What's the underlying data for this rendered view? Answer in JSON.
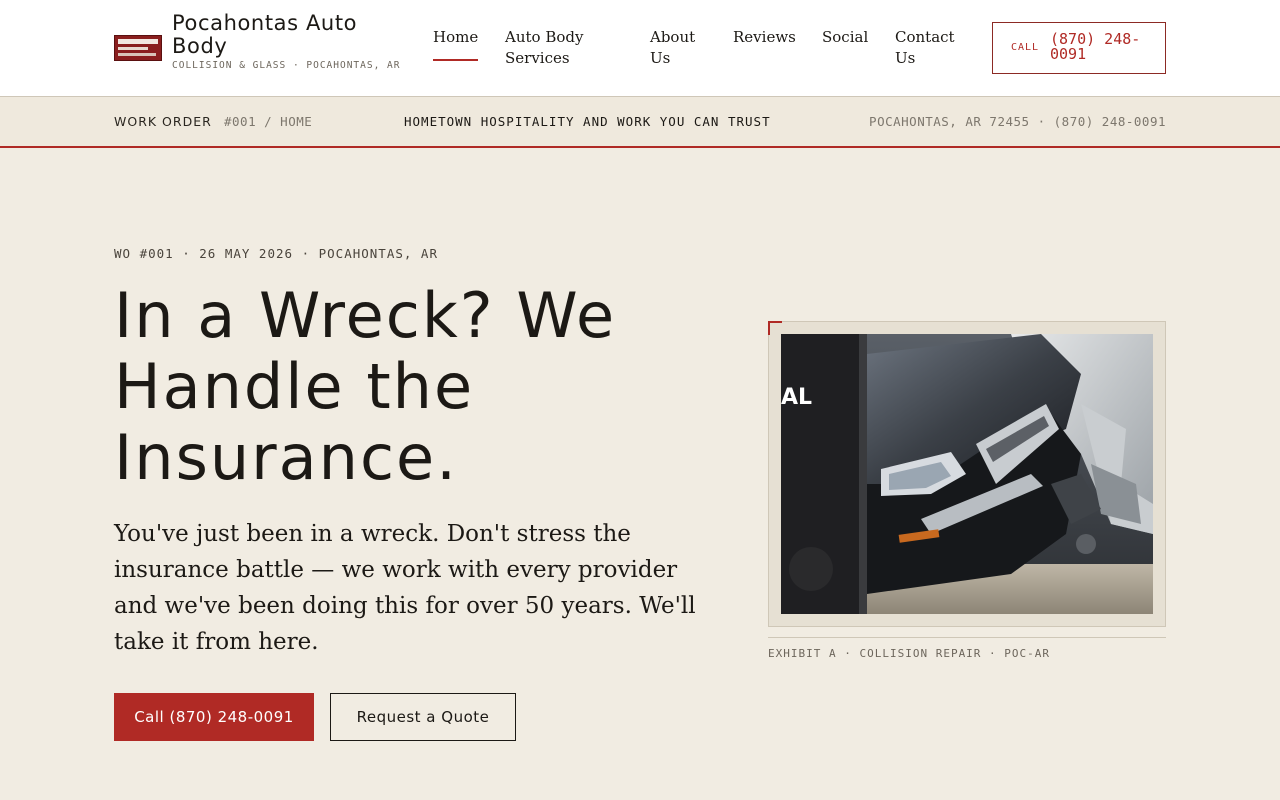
{
  "brand": {
    "name": "Pocahontas Auto Body",
    "tagline": "COLLISION & GLASS · POCAHONTAS, AR",
    "logo_text": "Pocahontas Auto Body"
  },
  "nav": {
    "items": [
      {
        "label": "Home",
        "active": true
      },
      {
        "label": "Auto Body Services",
        "active": false
      },
      {
        "label": "About Us",
        "active": false
      },
      {
        "label": "Reviews",
        "active": false
      },
      {
        "label": "Social",
        "active": false
      },
      {
        "label": "Contact Us",
        "active": false
      }
    ],
    "call_label": "CALL",
    "call_number": "(870) 248-0091"
  },
  "strip": {
    "work_order_label": "WORK ORDER",
    "path": "#001 / HOME",
    "slogan": "HOMETOWN HOSPITALITY AND WORK YOU CAN TRUST",
    "address": "POCAHONTAS, AR 72455 · (870) 248-0091"
  },
  "hero": {
    "meta": "WO #001 · 26 MAY 2026 · POCAHONTAS, AR",
    "headline": "In a Wreck? We Handle the Insurance.",
    "lead": "You've just been in a wreck. Don't stress the insurance battle — we work with every provider and we've been doing this for over 50 years. We'll take it from here.",
    "primary_cta": "Call (870) 248-0091",
    "secondary_cta": "Request a Quote"
  },
  "exhibit": {
    "photo_text": "AL",
    "caption": "EXHIBIT A · COLLISION REPAIR · POC-AR"
  },
  "colors": {
    "accent": "#b02a25",
    "background": "#f1ece2",
    "text": "#1c1915"
  }
}
